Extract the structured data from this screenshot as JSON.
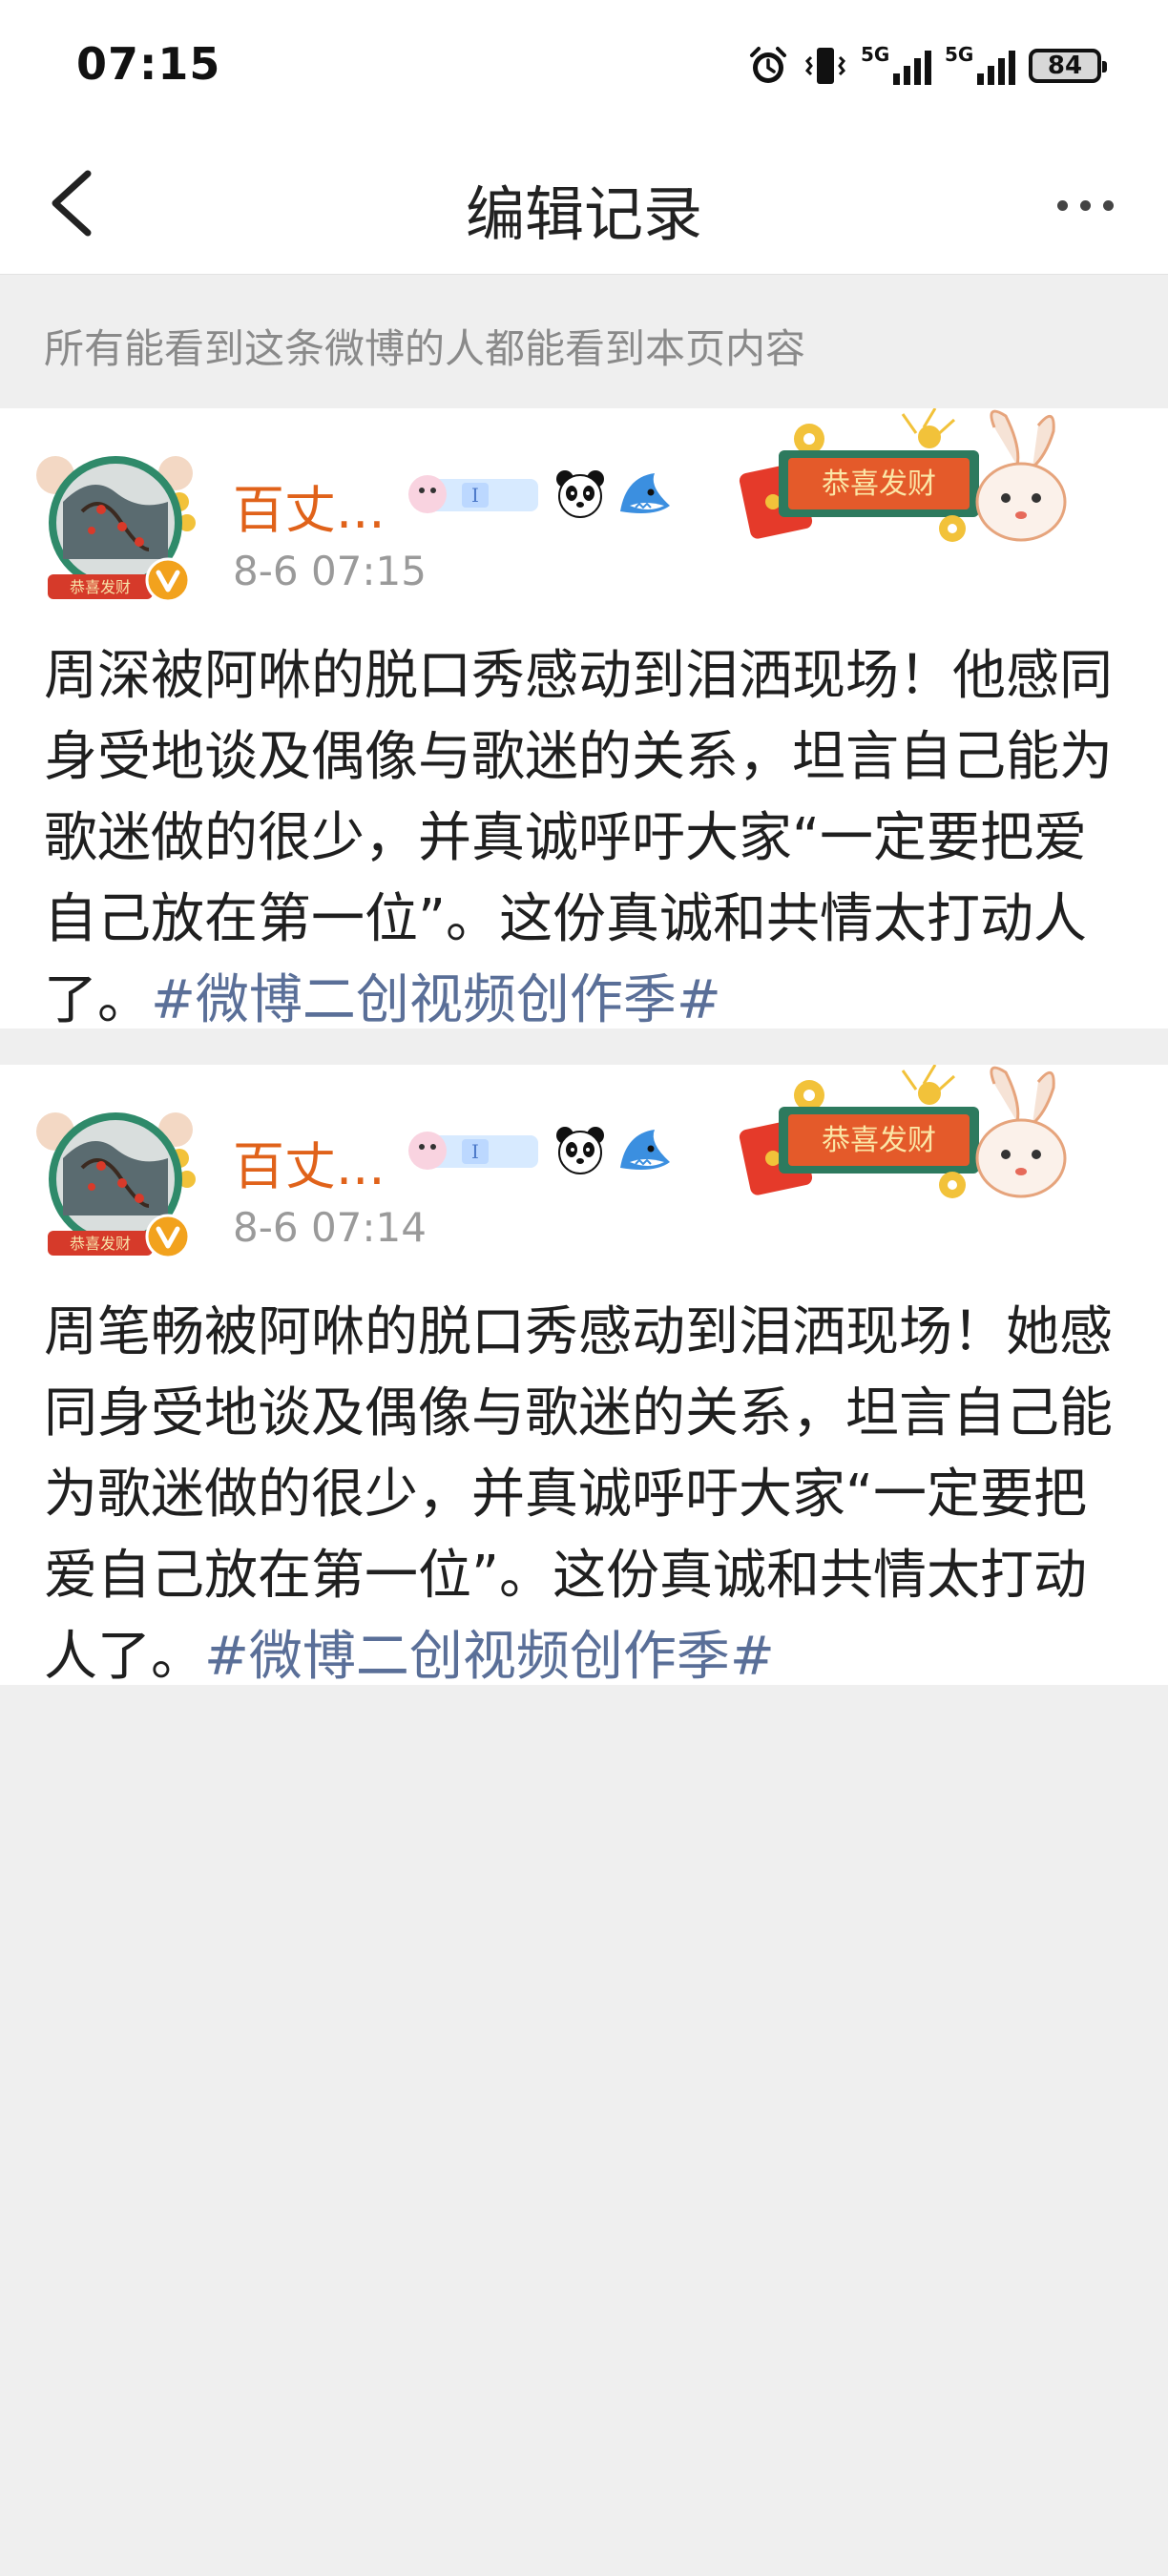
{
  "status_bar": {
    "time": "07:15",
    "battery": "84",
    "network_1": "5G",
    "network_2": "5G"
  },
  "nav": {
    "title": "编辑记录"
  },
  "notice": "所有能看到这条微博的人都能看到本页内容",
  "posts": [
    {
      "username": "百丈...",
      "time": "8-6 07:15",
      "text": "周深被阿咻的脱口秀感动到泪洒现场！他感同身受地谈及偶像与歌迷的关系，坦言自己能为歌迷做的很少，并真诚呼吁大家“一定要把爱自己放在第一位”。这份真诚和共情太打动人了。",
      "topic": "#微博二创视频创作季#",
      "decor_text": "恭喜发财",
      "avatar_badge": "恭喜发财"
    },
    {
      "username": "百丈...",
      "time": "8-6 07:14",
      "text": "周笔畅被阿咻的脱口秀感动到泪洒现场！她感同身受地谈及偶像与歌迷的关系，坦言自己能为歌迷做的很少，并真诚呼吁大家“一定要把爱自己放在第一位”。这份真诚和共情太打动人了。",
      "topic": "#微博二创视频创作季#",
      "decor_text": "恭喜发财",
      "avatar_badge": "恭喜发财"
    }
  ],
  "colors": {
    "username": "#e0621a",
    "topic": "#5a6f98",
    "notice": "#8a8a8a",
    "background": "#efefef"
  },
  "icons": [
    "back-arrow-icon",
    "more-icon",
    "alarm-icon",
    "vibrate-icon",
    "signal-icon",
    "battery-icon",
    "verified-v-icon",
    "panda-icon",
    "shark-icon",
    "fan-badge-icon"
  ]
}
